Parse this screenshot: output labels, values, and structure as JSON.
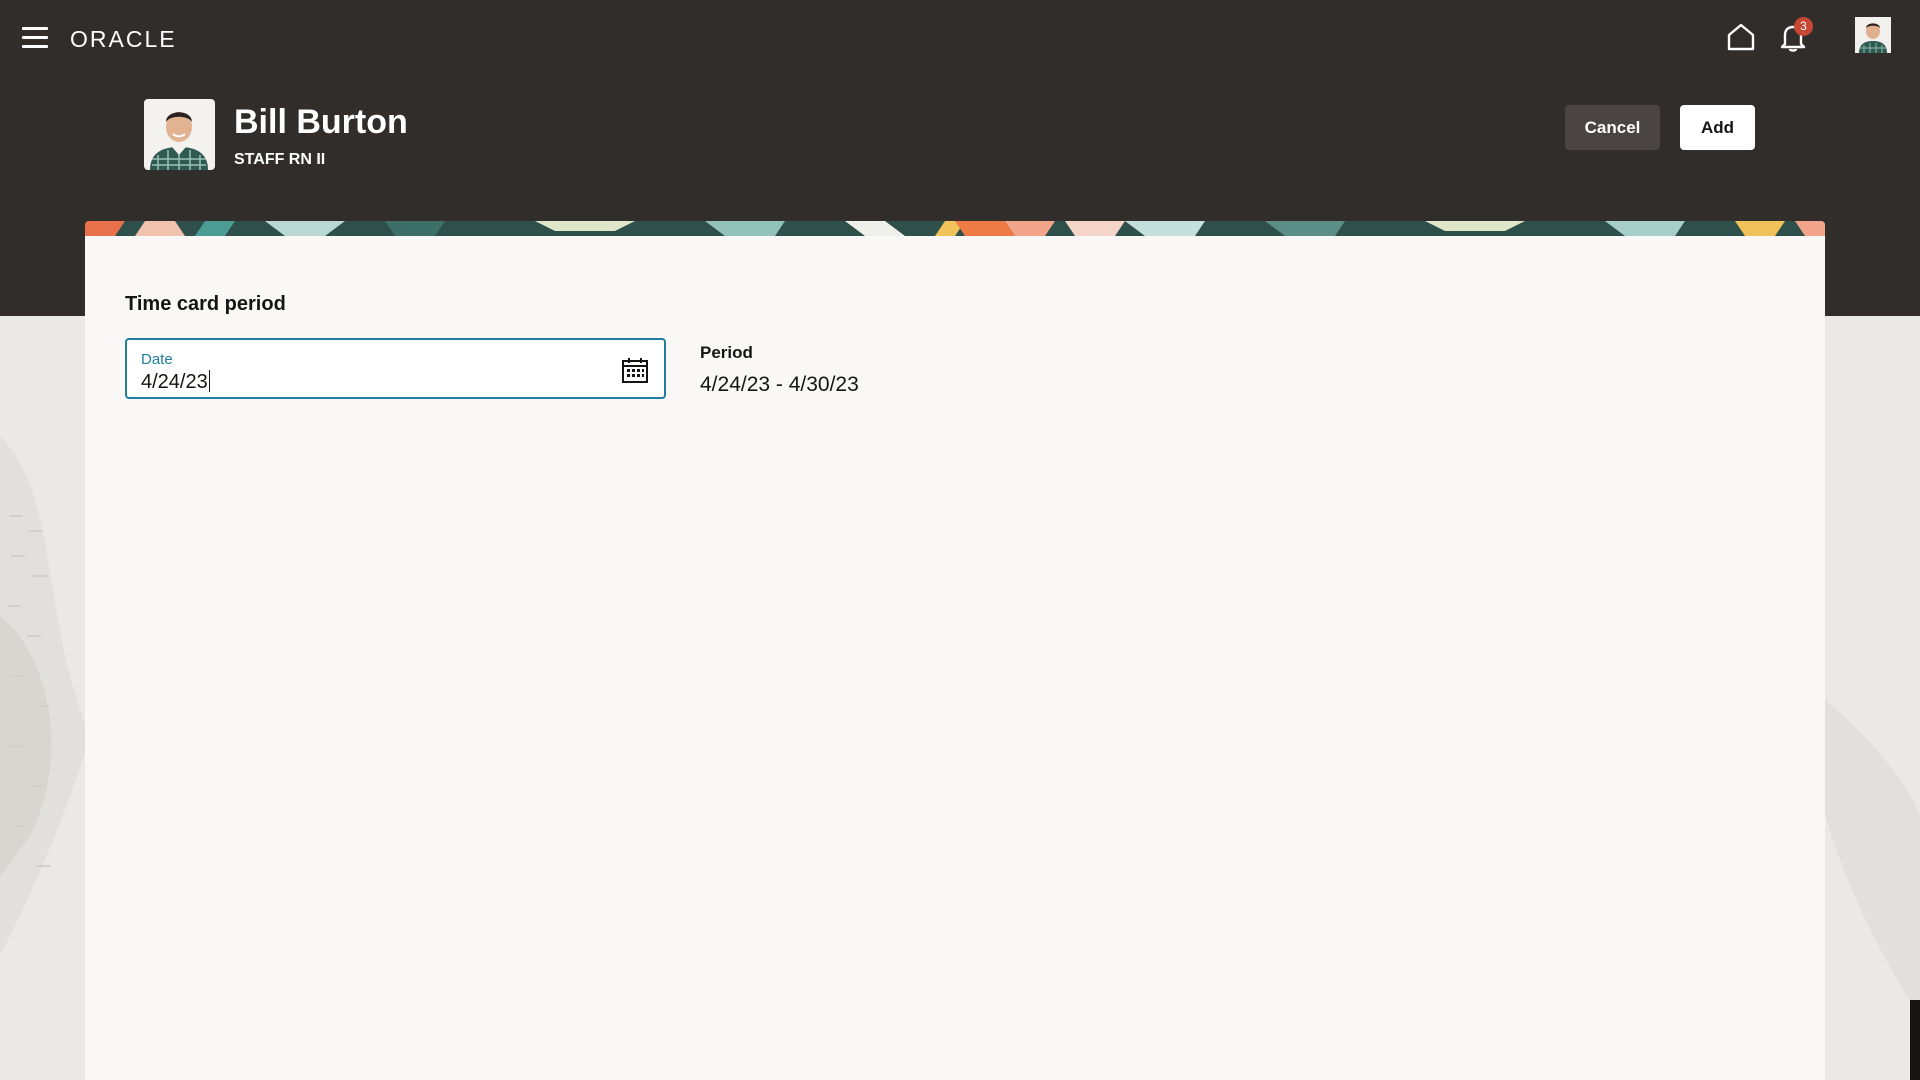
{
  "topbar": {
    "logo": "ORACLE",
    "notifications_count": "3",
    "icons": [
      "menu-icon",
      "home-icon",
      "bell-icon",
      "user-avatar"
    ]
  },
  "header": {
    "name": "Bill Burton",
    "job_title": "STAFF RN II"
  },
  "actions": {
    "cancel_label": "Cancel",
    "add_label": "Add"
  },
  "form": {
    "section_title": "Time card period",
    "date_label": "Date",
    "date_value": "4/24/23",
    "period_label": "Period",
    "period_value": "4/24/23 - 4/30/23",
    "calendar_icon": "calendar-icon"
  },
  "colors": {
    "header_bg": "#312d2a",
    "accent": "#227e9e",
    "badge": "#c74634",
    "card_bg": "#f9f8f6"
  }
}
